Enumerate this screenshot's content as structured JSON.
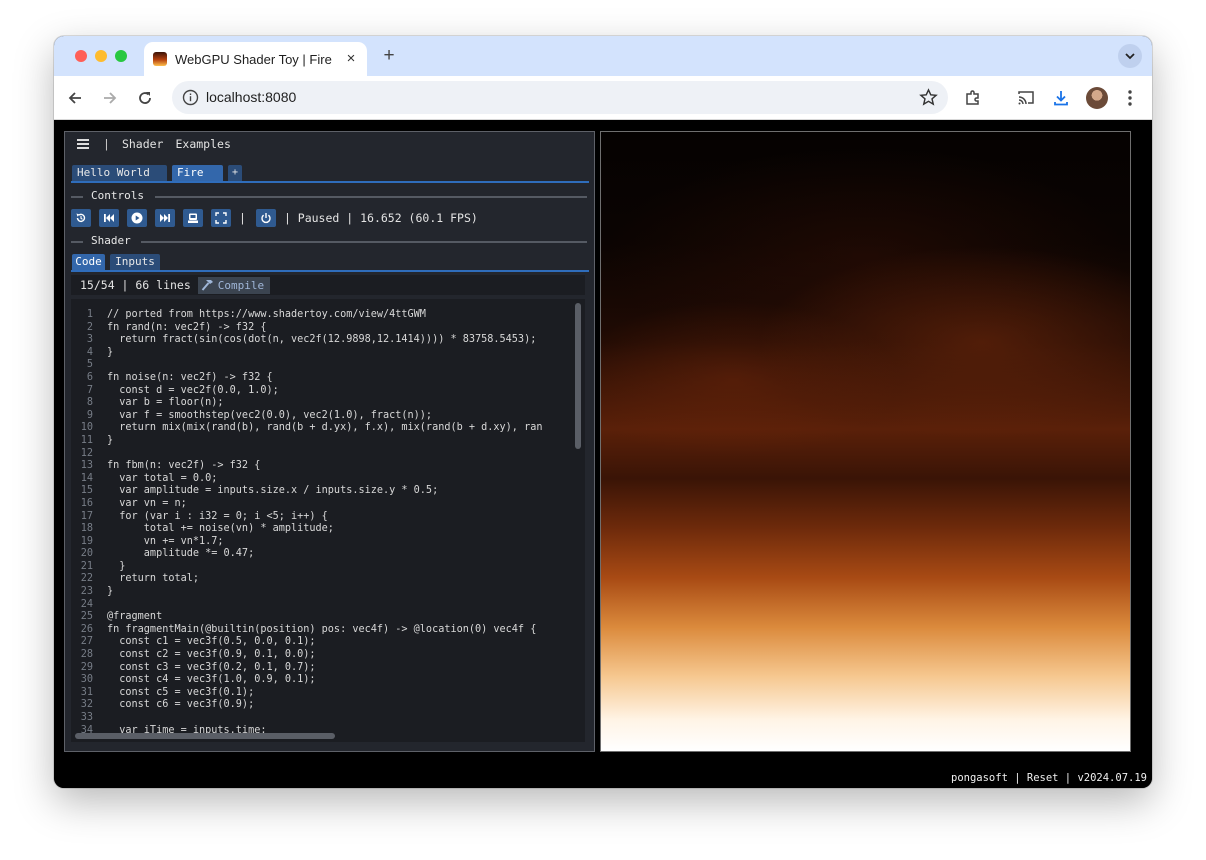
{
  "browser": {
    "tab_title": "WebGPU Shader Toy | Fire",
    "tab_close": "×",
    "new_tab": "+",
    "url": "localhost:8080"
  },
  "app": {
    "menu_separator": "|",
    "menu": [
      "Shader",
      "Examples"
    ],
    "shader_tabs": [
      "Hello World",
      "Fire",
      "+"
    ],
    "controls_section": "Controls",
    "status_separator": "|",
    "status": "| Paused | 16.652 (60.1 FPS)",
    "shader_section": "Shader",
    "code_tabs": [
      "Code",
      "Inputs"
    ],
    "editor_status": "15/54 | 66 lines",
    "compile_label": "Compile",
    "code": [
      {
        "n": "1",
        "t": "// ported from https://www.shadertoy.com/view/4ttGWM"
      },
      {
        "n": "2",
        "t": "fn rand(n: vec2f) -> f32 {"
      },
      {
        "n": "3",
        "t": "  return fract(sin(cos(dot(n, vec2f(12.9898,12.1414)))) * 83758.5453);"
      },
      {
        "n": "4",
        "t": "}"
      },
      {
        "n": "5",
        "t": ""
      },
      {
        "n": "6",
        "t": "fn noise(n: vec2f) -> f32 {"
      },
      {
        "n": "7",
        "t": "  const d = vec2f(0.0, 1.0);"
      },
      {
        "n": "8",
        "t": "  var b = floor(n);"
      },
      {
        "n": "9",
        "t": "  var f = smoothstep(vec2(0.0), vec2(1.0), fract(n));"
      },
      {
        "n": "10",
        "t": "  return mix(mix(rand(b), rand(b + d.yx), f.x), mix(rand(b + d.xy), ran"
      },
      {
        "n": "11",
        "t": "}"
      },
      {
        "n": "12",
        "t": ""
      },
      {
        "n": "13",
        "t": "fn fbm(n: vec2f) -> f32 {"
      },
      {
        "n": "14",
        "t": "  var total = 0.0;"
      },
      {
        "n": "15",
        "t": "  var amplitude = inputs.size.x / inputs.size.y * 0.5;"
      },
      {
        "n": "16",
        "t": "  var vn = n;"
      },
      {
        "n": "17",
        "t": "  for (var i : i32 = 0; i <5; i++) {"
      },
      {
        "n": "18",
        "t": "      total += noise(vn) * amplitude;"
      },
      {
        "n": "19",
        "t": "      vn += vn*1.7;"
      },
      {
        "n": "20",
        "t": "      amplitude *= 0.47;"
      },
      {
        "n": "21",
        "t": "  }"
      },
      {
        "n": "22",
        "t": "  return total;"
      },
      {
        "n": "23",
        "t": "}"
      },
      {
        "n": "24",
        "t": ""
      },
      {
        "n": "25",
        "t": "@fragment"
      },
      {
        "n": "26",
        "t": "fn fragmentMain(@builtin(position) pos: vec4f) -> @location(0) vec4f {"
      },
      {
        "n": "27",
        "t": "  const c1 = vec3f(0.5, 0.0, 0.1);"
      },
      {
        "n": "28",
        "t": "  const c2 = vec3f(0.9, 0.1, 0.0);"
      },
      {
        "n": "29",
        "t": "  const c3 = vec3f(0.2, 0.1, 0.7);"
      },
      {
        "n": "30",
        "t": "  const c4 = vec3f(1.0, 0.9, 0.1);"
      },
      {
        "n": "31",
        "t": "  const c5 = vec3f(0.1);"
      },
      {
        "n": "32",
        "t": "  const c6 = vec3f(0.9);"
      },
      {
        "n": "33",
        "t": ""
      },
      {
        "n": "34",
        "t": "  var iTime = inputs.time;"
      }
    ],
    "footer": {
      "brand": "pongasoft",
      "sep1": " | ",
      "reset": "Reset",
      "sep2": " | ",
      "version": "v2024.07.19"
    }
  },
  "icons": {
    "controls": [
      "reset-icon",
      "skip-back-icon",
      "play-icon",
      "skip-forward-icon",
      "screenshot-icon",
      "fullscreen-icon",
      "power-icon"
    ]
  },
  "colors": {
    "tab_strip": "#d3e3fd",
    "panel_bg": "#23262d",
    "accent": "#2f6dbb",
    "button": "#2f5a90"
  }
}
